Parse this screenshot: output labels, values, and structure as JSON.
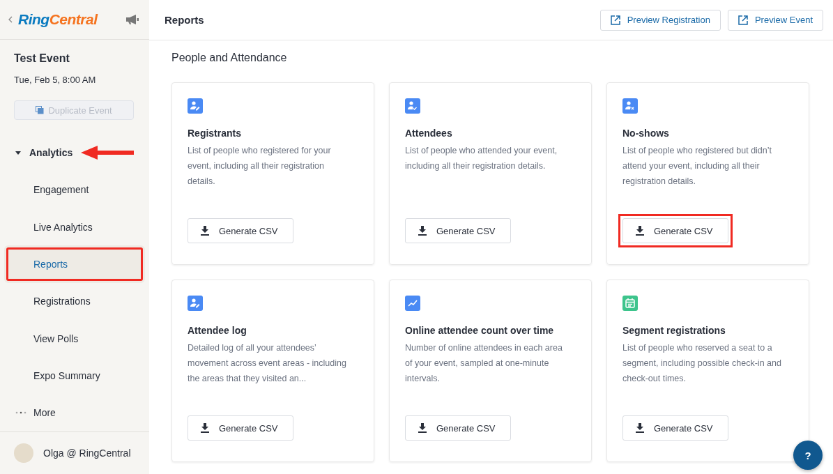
{
  "logo": {
    "parts": [
      {
        "text": "Ring",
        "color": "#0b7bc0"
      },
      {
        "text": "Central",
        "color": "#f5731f"
      }
    ]
  },
  "event": {
    "title": "Test Event",
    "date": "Tue, Feb 5, 8:00 AM",
    "duplicate_button": {
      "label": "Duplicate Event",
      "disabled": true
    }
  },
  "nav": {
    "group": {
      "label": "Analytics",
      "expanded": true,
      "arrow_annotation": true
    },
    "items": [
      {
        "label": "Engagement",
        "selected": false,
        "highlighted": false
      },
      {
        "label": "Live Analytics",
        "selected": false,
        "highlighted": false
      },
      {
        "label": "Reports",
        "selected": true,
        "highlighted": true
      },
      {
        "label": "Registrations",
        "selected": false,
        "highlighted": false
      },
      {
        "label": "View Polls",
        "selected": false,
        "highlighted": false
      },
      {
        "label": "Expo Summary",
        "selected": false,
        "highlighted": false
      }
    ],
    "more": "More"
  },
  "user": {
    "name": "Olga @ RingCentral"
  },
  "header": {
    "title": "Reports",
    "buttons": [
      "Preview Registration",
      "Preview Event"
    ]
  },
  "section": {
    "title": "People and Attendance"
  },
  "cards": [
    {
      "kind": "person-edit",
      "color": "#4a8af4",
      "title": "Registrants",
      "description": "List of people who registered for your event, including all their registration details.",
      "button": "Generate CSV",
      "highlighted": false
    },
    {
      "kind": "person-check",
      "color": "#4a8af4",
      "title": "Attendees",
      "description": "List of people who attended your event, including all their registration details.",
      "button": "Generate CSV",
      "highlighted": false
    },
    {
      "kind": "person-x",
      "color": "#4a8af4",
      "title": "No-shows",
      "description": "List of people who registered but didn’t attend your event, including all their registration details.",
      "button": "Generate CSV",
      "highlighted": true
    },
    {
      "kind": "person-edit",
      "color": "#4a8af4",
      "title": "Attendee log",
      "description": "Detailed log of all your attendees’ movement across event areas - including the areas that they visited an...",
      "button": "Generate CSV",
      "highlighted": false
    },
    {
      "kind": "chart",
      "color": "#4a8af4",
      "title": "Online attendee count over time",
      "description": "Number of online attendees in each area of your event, sampled at one-minute intervals.",
      "button": "Generate CSV",
      "highlighted": false
    },
    {
      "kind": "calendar",
      "color": "#3dc48c",
      "title": "Segment registrations",
      "description": "List of people who reserved a seat to a segment, including possible check-in and check-out times.",
      "button": "Generate CSV",
      "highlighted": false
    }
  ],
  "help_button": "?"
}
